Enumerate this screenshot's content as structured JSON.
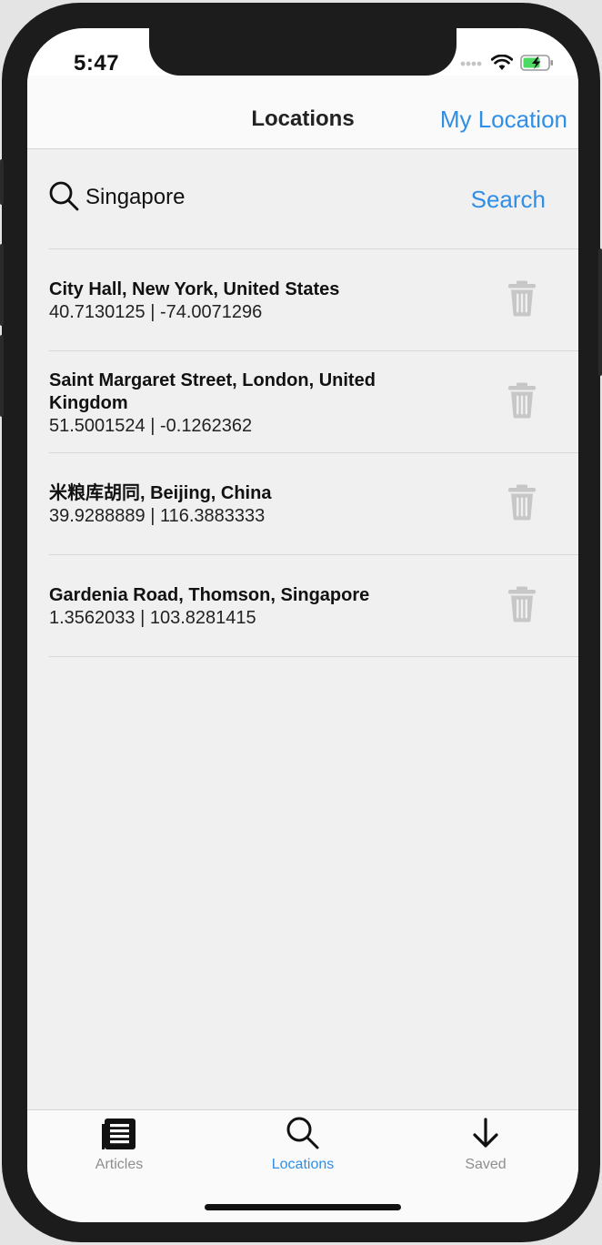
{
  "status_bar": {
    "time": "5:47"
  },
  "nav": {
    "title": "Locations",
    "right_button": "My Location"
  },
  "search": {
    "value": "Singapore",
    "button_label": "Search"
  },
  "locations": [
    {
      "name": "City Hall, New York, United States",
      "coords": "40.7130125 | -74.0071296"
    },
    {
      "name": "Saint Margaret Street, London, United Kingdom",
      "coords": "51.5001524 | -0.1262362"
    },
    {
      "name": "米粮库胡同, Beijing, China",
      "coords": "39.9288889 | 116.3883333"
    },
    {
      "name": "Gardenia Road, Thomson, Singapore",
      "coords": "1.3562033 | 103.8281415"
    }
  ],
  "tabs": [
    {
      "label": "Articles",
      "icon": "articles-icon",
      "active": false
    },
    {
      "label": "Locations",
      "icon": "search-icon",
      "active": true
    },
    {
      "label": "Saved",
      "icon": "download-arrow-icon",
      "active": false
    }
  ],
  "colors": {
    "accent": "#2f8ee6",
    "background": "#f0f0f0",
    "inactive": "#8e8e8e",
    "trash": "#c7c7c7",
    "battery": "#4cd964"
  }
}
